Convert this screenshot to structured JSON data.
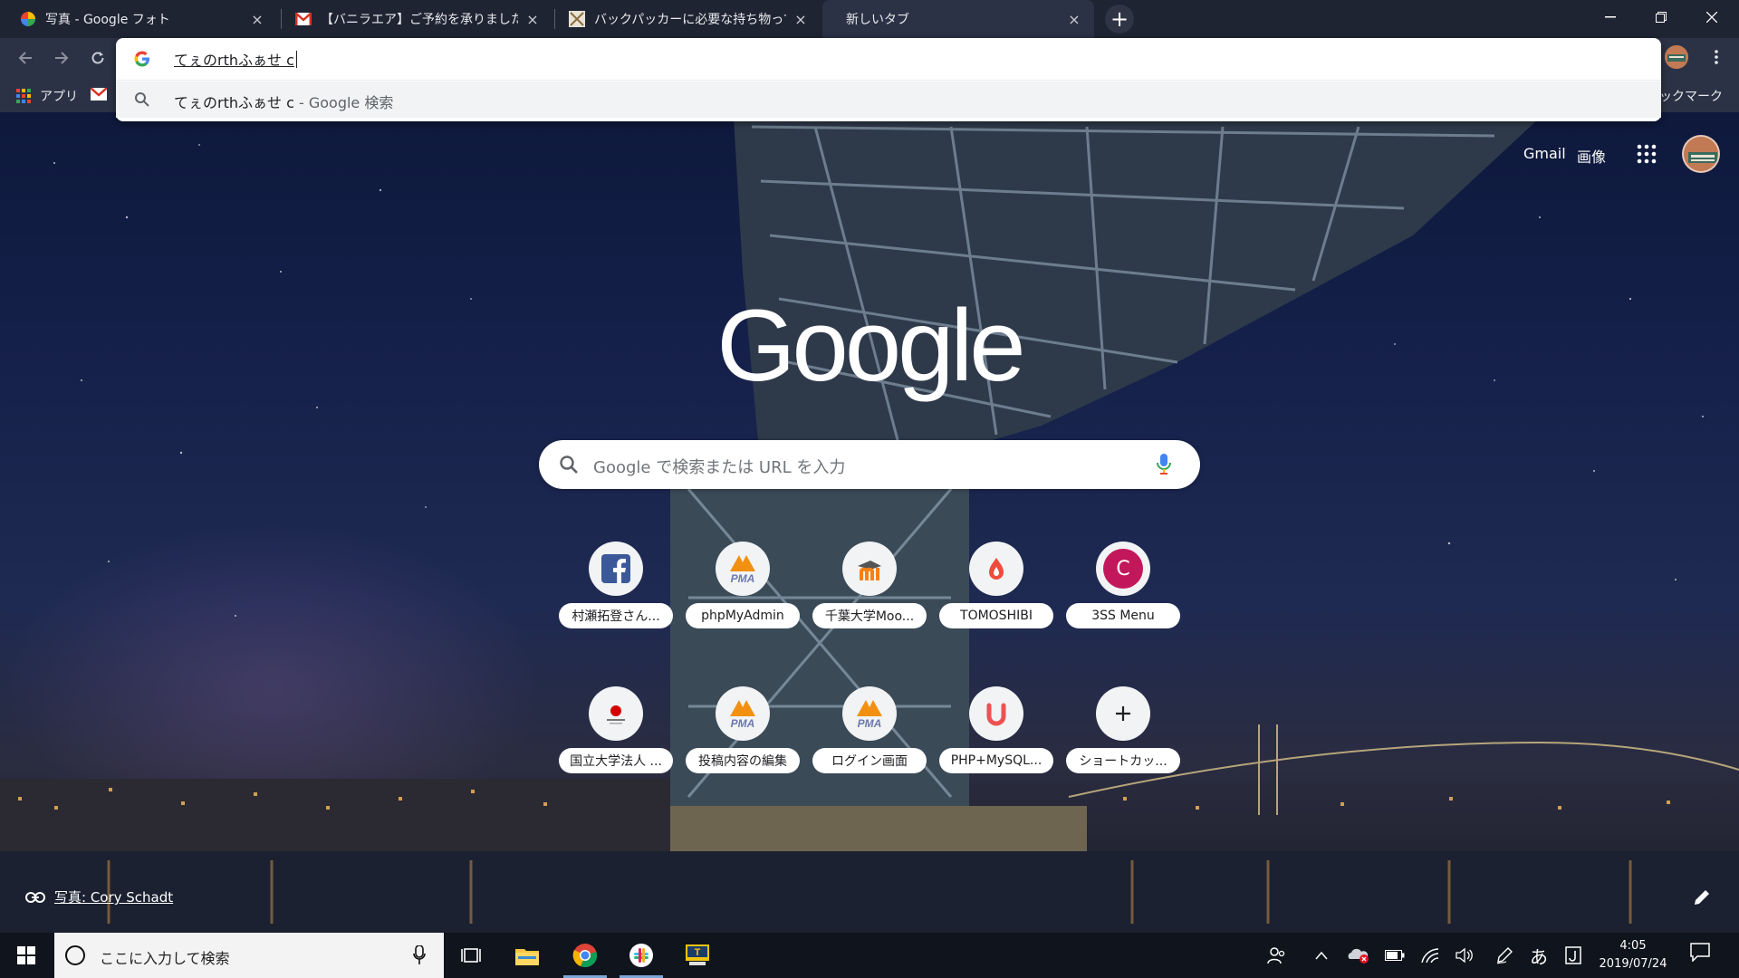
{
  "tabs": [
    {
      "title": "写真 - Google フォト",
      "icon": "google-photos-icon",
      "active": false
    },
    {
      "title": "【バニラエア】ご予約を承りました（予約",
      "icon": "gmail-icon",
      "active": false
    },
    {
      "title": "バックパッカーに必要な持ち物って？必",
      "icon": "site-favicon",
      "active": false
    },
    {
      "title": "新しいタブ",
      "icon": "none",
      "active": true
    }
  ],
  "tab_close": "×",
  "bookmarks": {
    "apps_label": "アプリ",
    "other_label": "のブックマーク"
  },
  "omnibox": {
    "typed": "てぇのrthふぁせ c",
    "suggestion_main": "てぇのrthふぁせ c",
    "suggestion_suffix": " - Google 検索"
  },
  "ntp": {
    "gmail_label": "Gmail",
    "images_label": "画像",
    "search_placeholder": "Google で検索または URL を入力",
    "shortcuts": [
      {
        "label": "村瀬拓登さん...",
        "icon": "facebook-icon"
      },
      {
        "label": "phpMyAdmin",
        "icon": "phpmyadmin-icon"
      },
      {
        "label": "千葉大学Moo...",
        "icon": "moodle-icon"
      },
      {
        "label": "TOMOSHIBI",
        "icon": "tomoshibi-icon"
      },
      {
        "label": "3SS Menu",
        "icon": "c-letter-icon",
        "letter": "C"
      },
      {
        "label": "国立大学法人 ...",
        "icon": "university-logo-icon"
      },
      {
        "label": "投稿内容の編集",
        "icon": "phpmyadmin-icon"
      },
      {
        "label": "ログイン画面",
        "icon": "phpmyadmin-icon"
      },
      {
        "label": "PHP+MySQL...",
        "icon": "udemy-icon"
      },
      {
        "label": "ショートカッ...",
        "icon": "plus-icon"
      }
    ],
    "photo_credit": "写真: Cory Schadt"
  },
  "taskbar": {
    "search_placeholder": "ここに入力して検索",
    "ime": "あ",
    "time": "4:05",
    "date": "2019/07/24"
  }
}
